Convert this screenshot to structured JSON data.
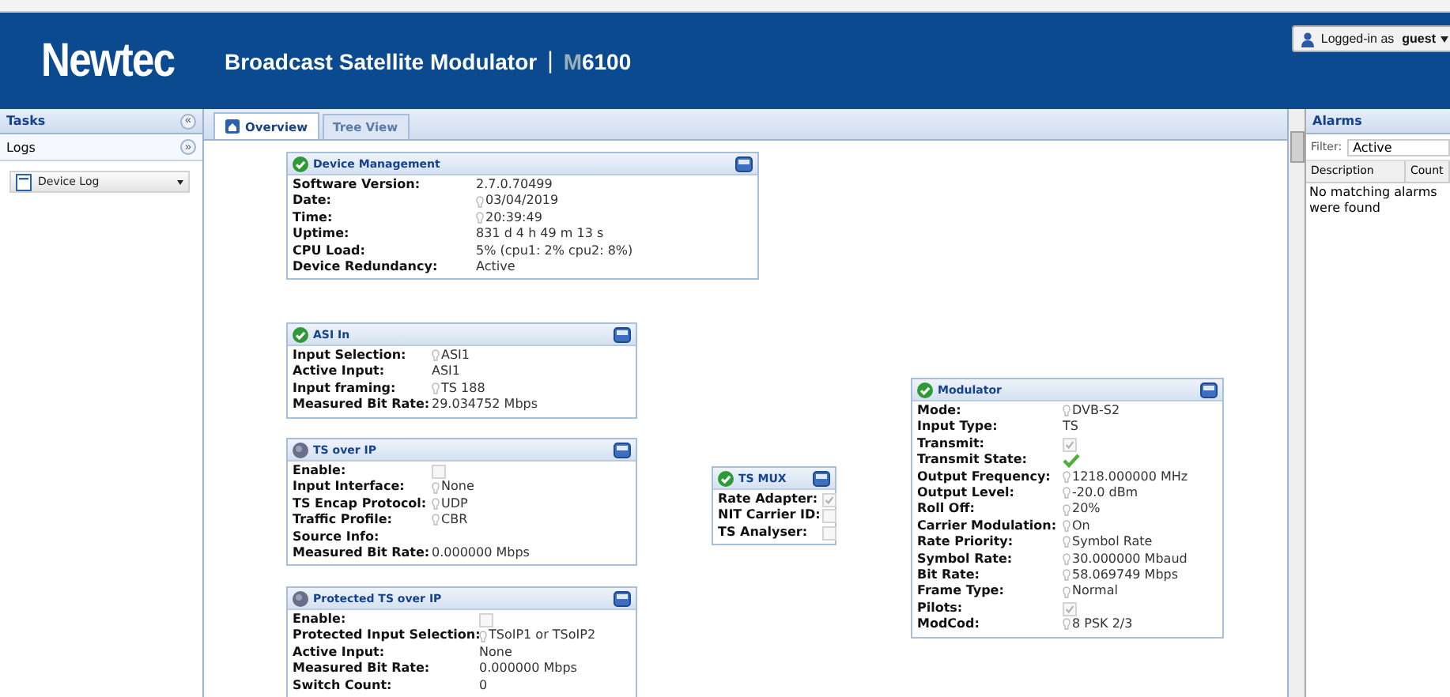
{
  "header": {
    "logo": "Newtec",
    "title": "Broadcast Satellite Modulator",
    "separator": "|",
    "model_prefix": "M",
    "model": "6100",
    "user_prefix": "Logged-in as",
    "user": "guest"
  },
  "tasks": {
    "title": "Tasks",
    "collapse": "«",
    "section": "Logs",
    "section_toggle": "»",
    "dropdown": "Device Log"
  },
  "tabs": [
    {
      "label": "Overview",
      "selected": true
    },
    {
      "label": "Tree View",
      "selected": false
    }
  ],
  "panels": [
    {
      "title": "Device Management",
      "ok": true,
      "rows": [
        {
          "label": "Software Version:",
          "kind": "text",
          "value": "2.7.0.70499"
        },
        {
          "label": "Date:",
          "kind": "setting",
          "value": "03/04/2019"
        },
        {
          "label": "Time:",
          "kind": "setting",
          "value": "20:39:49"
        },
        {
          "label": "Uptime:",
          "kind": "text",
          "value": "831 d 4 h 49 m 13 s"
        },
        {
          "label": "CPU Load:",
          "kind": "text",
          "value": "5% (cpu1: 2% cpu2: 8%)"
        },
        {
          "label": "Device Redundancy:",
          "kind": "text",
          "value": "Active"
        }
      ]
    },
    {
      "title": "ASI In",
      "ok": true,
      "rows": [
        {
          "label": "Input Selection:",
          "kind": "setting",
          "value": "ASI1"
        },
        {
          "label": "Active Input:",
          "kind": "text",
          "value": "ASI1"
        },
        {
          "label": "Input framing:",
          "kind": "setting",
          "value": "TS 188"
        },
        {
          "label": "Measured Bit Rate:",
          "kind": "text",
          "value": "29.034752 Mbps"
        }
      ]
    },
    {
      "title": "TS over IP",
      "ok": false,
      "rows": [
        {
          "label": "Enable:",
          "kind": "checkbox",
          "checked": false
        },
        {
          "label": "Input Interface:",
          "kind": "setting",
          "value": "None"
        },
        {
          "label": "TS Encap Protocol:",
          "kind": "setting",
          "value": "UDP"
        },
        {
          "label": "Traffic Profile:",
          "kind": "setting",
          "value": "CBR"
        },
        {
          "label": "Source Info:",
          "kind": "text"
        },
        {
          "label": "Measured Bit Rate:",
          "kind": "text",
          "value": "0.000000 Mbps"
        }
      ]
    },
    {
      "title": "Protected TS over IP",
      "ok": false,
      "rows": [
        {
          "label": "Enable:",
          "kind": "checkbox",
          "checked": false
        },
        {
          "label": "Protected Input Selection:",
          "kind": "setting",
          "value": "TSoIP1 or TSoIP2"
        },
        {
          "label": "Active Input:",
          "kind": "text",
          "value": "None"
        },
        {
          "label": "Measured Bit Rate:",
          "kind": "text",
          "value": "0.000000 Mbps"
        },
        {
          "label": "Switch Count:",
          "kind": "text",
          "value": "0"
        }
      ]
    },
    {
      "title": "TS MUX",
      "ok": true,
      "rows": [
        {
          "label": "Rate Adapter:",
          "kind": "checkbox",
          "checked": true
        },
        {
          "label": "NIT Carrier ID:",
          "kind": "checkbox",
          "checked": false
        },
        {
          "label": "TS Analyser:",
          "kind": "checkbox",
          "checked": false
        }
      ]
    },
    {
      "title": "Modulator",
      "ok": true,
      "rows": [
        {
          "label": "Mode:",
          "kind": "setting",
          "value": "DVB-S2"
        },
        {
          "label": "Input Type:",
          "kind": "text",
          "value": "TS"
        },
        {
          "label": "Transmit:",
          "kind": "checkbox",
          "checked": true
        },
        {
          "label": "Transmit State:",
          "kind": "tick"
        },
        {
          "label": "Output Frequency:",
          "kind": "setting",
          "value": "1218.000000 MHz"
        },
        {
          "label": "Output Level:",
          "kind": "setting",
          "value": "-20.0 dBm"
        },
        {
          "label": "Roll Off:",
          "kind": "setting",
          "value": "20%"
        },
        {
          "label": "Carrier Modulation:",
          "kind": "setting",
          "value": "On"
        },
        {
          "label": "Rate Priority:",
          "kind": "setting",
          "value": "Symbol Rate"
        },
        {
          "label": "Symbol Rate:",
          "kind": "setting",
          "value": "30.000000 Mbaud"
        },
        {
          "label": "Bit Rate:",
          "kind": "setting",
          "value": "58.069749 Mbps"
        },
        {
          "label": "Frame Type:",
          "kind": "setting",
          "value": "Normal"
        },
        {
          "label": "Pilots:",
          "kind": "checkbox",
          "checked": true
        },
        {
          "label": "ModCod:",
          "kind": "setting",
          "value": "8 PSK 2/3"
        }
      ]
    }
  ],
  "alarms": {
    "title": "Alarms",
    "filter_label": "Filter:",
    "filter": "Active",
    "columns": [
      "Description",
      "Count"
    ],
    "empty": "No matching alarms were found"
  }
}
